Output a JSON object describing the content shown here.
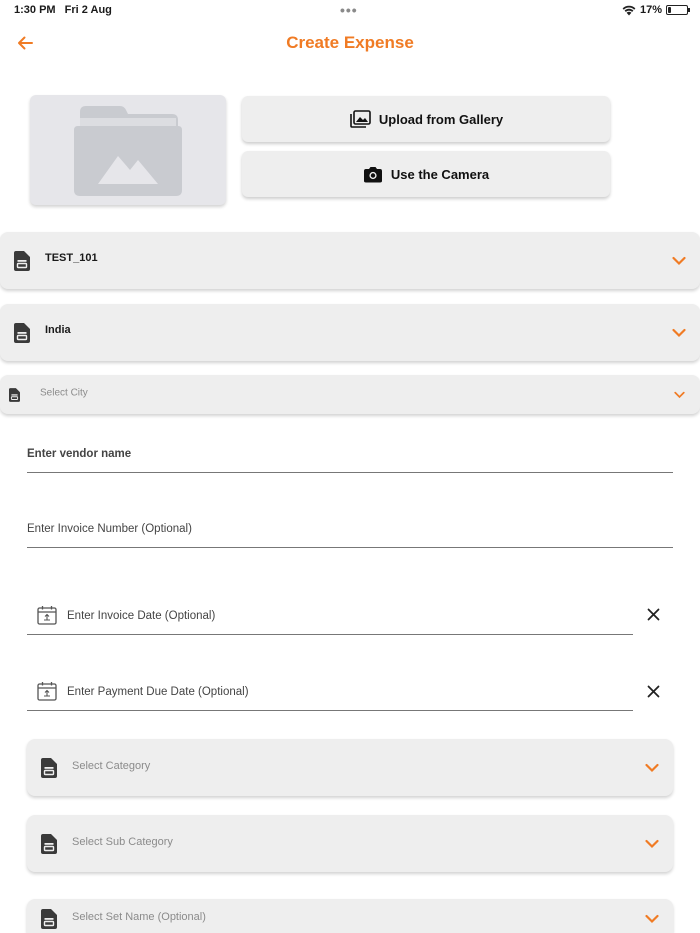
{
  "status_bar": {
    "time": "1:30 PM",
    "date": "Fri 2 Aug",
    "battery": "17%",
    "battery_level": 0.17
  },
  "header": {
    "title": "Create Expense",
    "back_icon": "arrow-left-icon"
  },
  "accent_color": "#f07b24",
  "image_picker": {
    "placeholder_icon": "folder-image-icon",
    "gallery_label": "Upload from Gallery",
    "camera_label": "Use the Camera"
  },
  "selects": {
    "project": {
      "value": "TEST_101"
    },
    "country": {
      "value": "India"
    },
    "city": {
      "placeholder": "Select City"
    },
    "category": {
      "placeholder": "Select Category"
    },
    "sub_category": {
      "placeholder": "Select Sub Category"
    },
    "set_name": {
      "placeholder": "Select Set Name (Optional)"
    }
  },
  "fields": {
    "vendor": {
      "placeholder": "Enter vendor name"
    },
    "invoice_number": {
      "placeholder": "Enter Invoice Number (Optional)"
    },
    "invoice_date": {
      "placeholder": "Enter Invoice Date (Optional)"
    },
    "payment_due_date": {
      "placeholder": "Enter Payment Due Date (Optional)"
    }
  }
}
